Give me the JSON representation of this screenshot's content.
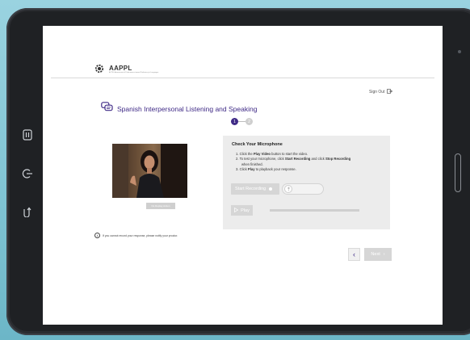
{
  "brand": {
    "name": "AAPPL",
    "tagline": "ACTFL Assessment of Performance toward Proficiency in Languages"
  },
  "header": {
    "sign_out_label": "Sign Out"
  },
  "test": {
    "title": "Spanish Interpersonal Listening and Speaking"
  },
  "steps": {
    "labels": [
      "1",
      "2"
    ],
    "current": 1
  },
  "video": {
    "button_label": "No Replay Action"
  },
  "mic_check": {
    "heading": "Check Your Microphone",
    "instructions": {
      "line1_prefix": "1. Click the ",
      "line1_bold": "Play Video",
      "line1_suffix": " button to start the video.",
      "line2_prefix": "2. To test your microphone, click ",
      "line2_bold1": "Start Recording",
      "line2_mid": " and click ",
      "line2_bold2": "Stop Recording",
      "line2_cont": "when finished.",
      "line3_prefix": "3. Click ",
      "line3_bold": "Play",
      "line3_suffix": " to playback your response."
    },
    "start_recording_label": "Start Recording",
    "play_label": "Play",
    "playback_progress": 0
  },
  "notice": {
    "text": "If you cannot record your response, please notify your proctor."
  },
  "nav": {
    "back_glyph": "‹",
    "next_label": "Next",
    "next_glyph": "›"
  },
  "colors": {
    "accent": "#3f2a86",
    "disabled": "#d6d6d6",
    "panel": "#ececec"
  }
}
